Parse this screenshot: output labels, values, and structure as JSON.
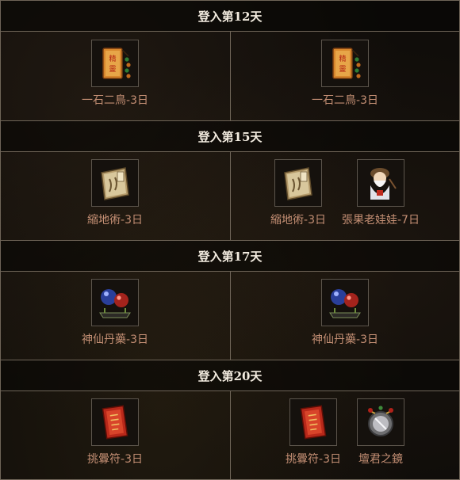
{
  "sections": [
    {
      "title": "登入第12天",
      "left": [
        {
          "icon": "spirit-talisman-icon",
          "label": "一石二鳥-3日"
        }
      ],
      "right": [
        {
          "icon": "spirit-talisman-icon",
          "label": "一石二鳥-3日"
        }
      ]
    },
    {
      "title": "登入第15天",
      "left": [
        {
          "icon": "scroll-book-icon",
          "label": "縮地術-3日"
        }
      ],
      "right": [
        {
          "icon": "scroll-book-icon",
          "label": "縮地術-3日"
        },
        {
          "icon": "old-man-doll-icon",
          "label": "張果老娃娃-7日"
        }
      ]
    },
    {
      "title": "登入第17天",
      "left": [
        {
          "icon": "elixir-orbs-icon",
          "label": "神仙丹藥-3日"
        }
      ],
      "right": [
        {
          "icon": "elixir-orbs-icon",
          "label": "神仙丹藥-3日"
        }
      ]
    },
    {
      "title": "登入第20天",
      "left": [
        {
          "icon": "challenge-talisman-icon",
          "label": "挑釁符-3日"
        }
      ],
      "right": [
        {
          "icon": "challenge-talisman-icon",
          "label": "挑釁符-3日"
        },
        {
          "icon": "altar-mirror-icon",
          "label": "壇君之鏡"
        }
      ]
    }
  ]
}
